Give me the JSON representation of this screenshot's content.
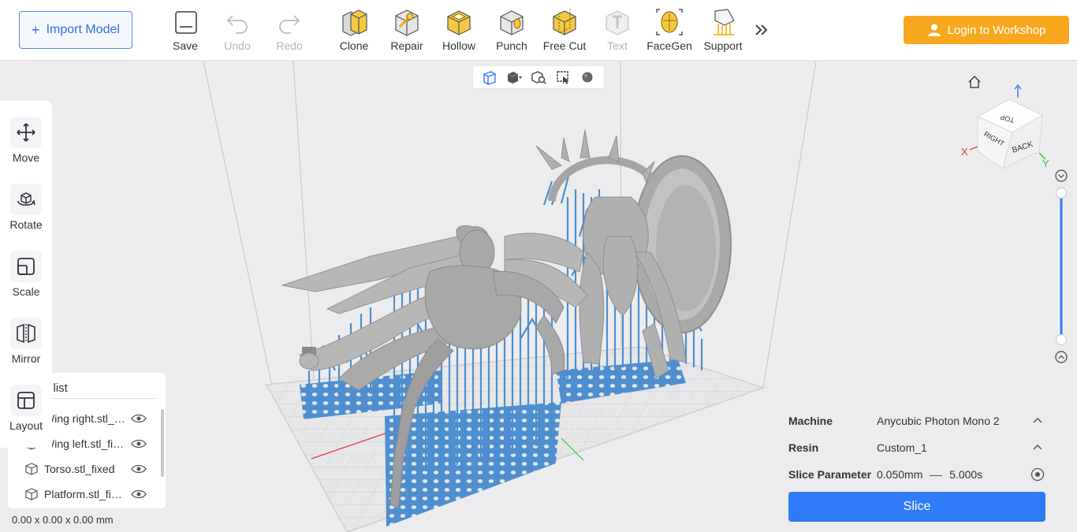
{
  "toolbar": {
    "import_label": "Import Model",
    "tools": [
      {
        "label": "Save",
        "enabled": true
      },
      {
        "label": "Undo",
        "enabled": false
      },
      {
        "label": "Redo",
        "enabled": false
      },
      {
        "label": "Clone",
        "enabled": true
      },
      {
        "label": "Repair",
        "enabled": true
      },
      {
        "label": "Hollow",
        "enabled": true
      },
      {
        "label": "Punch",
        "enabled": true
      },
      {
        "label": "Free Cut",
        "enabled": true
      },
      {
        "label": "Text",
        "enabled": false
      },
      {
        "label": "FaceGen",
        "enabled": true
      },
      {
        "label": "Support",
        "enabled": true
      }
    ],
    "login_label": "Login to Workshop"
  },
  "left_tools": [
    {
      "label": "Move",
      "icon": "move-icon"
    },
    {
      "label": "Rotate",
      "icon": "rotate-icon"
    },
    {
      "label": "Scale",
      "icon": "scale-icon"
    },
    {
      "label": "Mirror",
      "icon": "mirror-icon"
    },
    {
      "label": "Layout",
      "icon": "layout-icon"
    }
  ],
  "object_list": {
    "title": "Object list",
    "items": [
      {
        "name": "Wing right.stl_fixed"
      },
      {
        "name": "Wing left.stl_fixed"
      },
      {
        "name": "Torso.stl_fixed"
      },
      {
        "name": "Platform.stl_fixed"
      }
    ]
  },
  "dimensions": "0.00 x 0.00 x 0.00 mm",
  "nav_cube": {
    "top": "TOP",
    "right": "RIGHT",
    "back": "BACK",
    "axis_x": "X",
    "axis_y": "Y"
  },
  "settings": {
    "machine_label": "Machine",
    "machine_value": "Anycubic Photon Mono 2",
    "resin_label": "Resin",
    "resin_value": "Custom_1",
    "slice_param_label": "Slice Parameter",
    "layer_height": "0.050mm",
    "exposure": "5.000s"
  },
  "slice_label": "Slice",
  "colors": {
    "accent_blue": "#2f7bf5",
    "login_orange": "#f7a81e",
    "support_blue": "#4d8fcf",
    "model_gray": "#a8a8a8"
  }
}
